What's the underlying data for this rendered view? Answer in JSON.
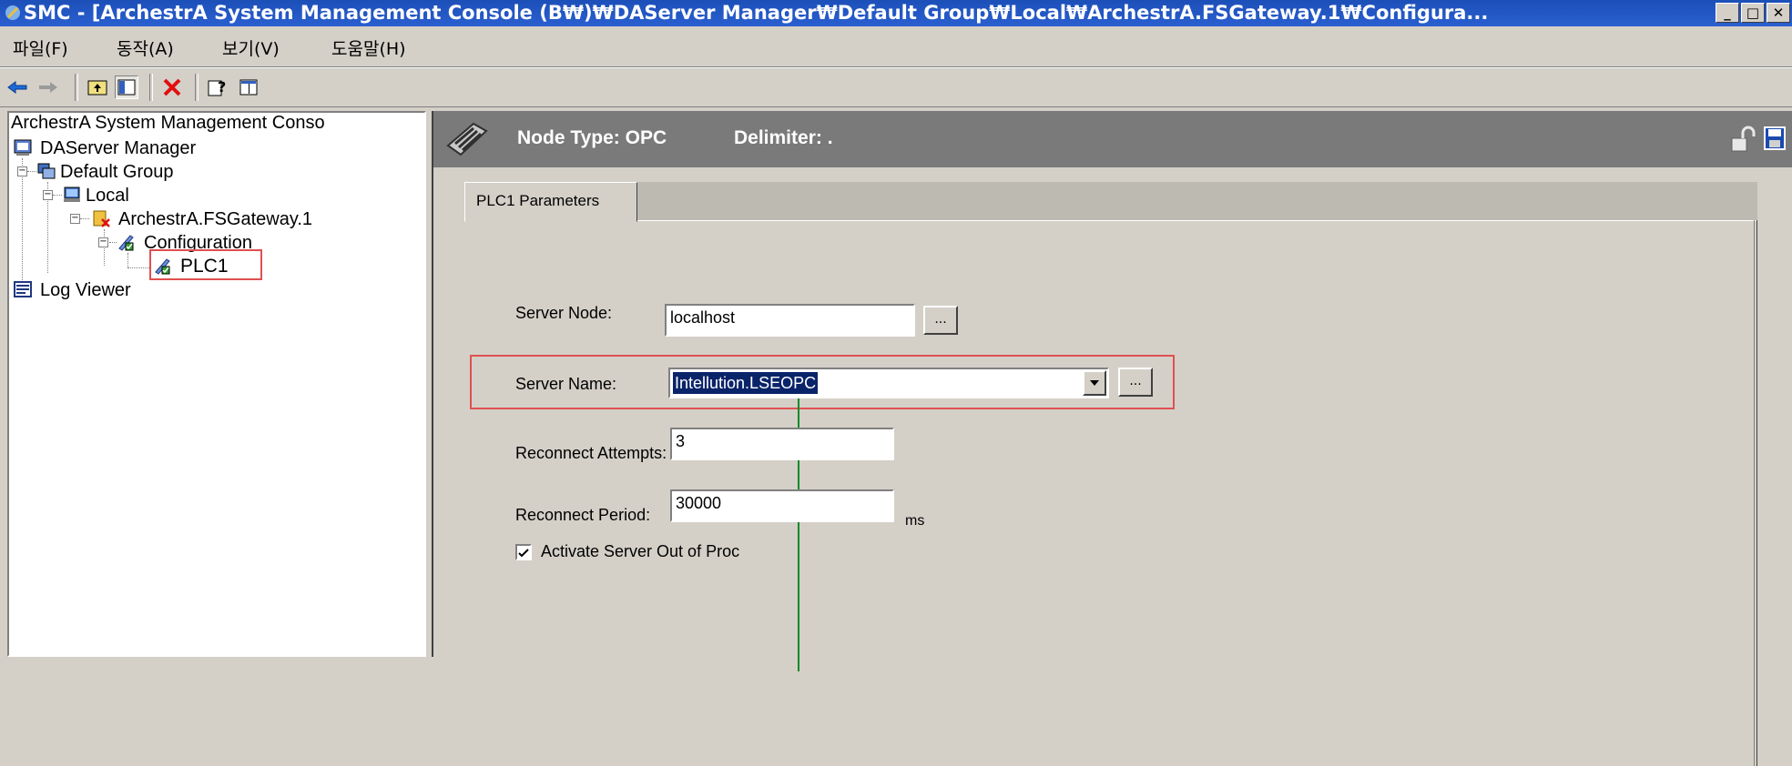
{
  "window": {
    "title": "SMC - [ArchestrA System Management Console (B₩)₩DAServer Manager₩Default Group₩Local₩ArchestrA.FSGateway.1₩Configura...",
    "min": "_",
    "max": "□",
    "close": "✕"
  },
  "menubar": {
    "items": [
      "파일(F)",
      "동작(A)",
      "보기(V)",
      "도움말(H)"
    ]
  },
  "tree": {
    "root": "ArchestrA System Management Conso",
    "daserver_manager": "DAServer Manager",
    "default_group": "Default Group",
    "local": "Local",
    "fsgateway": "ArchestrA.FSGateway.1",
    "configuration": "Configuration",
    "plc1": "PLC1",
    "log_viewer": "Log Viewer"
  },
  "header": {
    "node_type": "Node Type: OPC",
    "delimiter": "Delimiter: ."
  },
  "tab": {
    "label": "PLC1 Parameters"
  },
  "form": {
    "server_node_label": "Server Node:",
    "server_node_value": "localhost",
    "server_name_label": "Server Name:",
    "server_name_value": "Intellution.LSEOPC",
    "reconnect_attempts_label": "Reconnect Attempts:",
    "reconnect_attempts_value": "3",
    "reconnect_period_label": "Reconnect Period:",
    "reconnect_period_value": "30000",
    "reconnect_period_unit": "ms",
    "browse_label": "...",
    "activate_label": "Activate Server Out of Proc",
    "activate_checked": true
  },
  "colors": {
    "title_bar": "#1c4fb8",
    "header_bar": "#7a7a7a",
    "highlight_box": "#e05050",
    "selection": "#0a246a"
  }
}
